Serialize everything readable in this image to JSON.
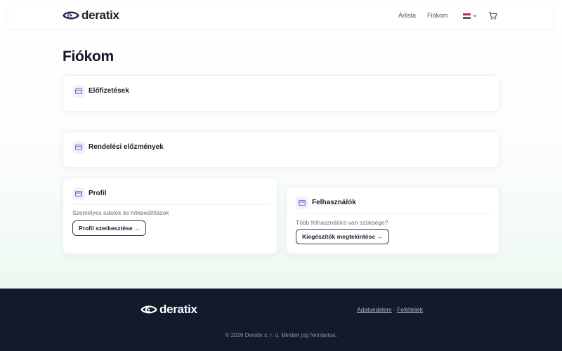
{
  "colors": {
    "text_primary": "#1c1d2b",
    "footer_bg": "#121a2e",
    "icon_accent": "#6b5bd6",
    "card_border": "#eef0f4",
    "page_gradient_end": "#eaf8ef"
  },
  "header": {
    "logo_text": "deratix",
    "nav": [
      {
        "label": "Árlista"
      },
      {
        "label": "Fiókom"
      }
    ],
    "language_icon": "hungary-flag-icon",
    "cart_icon": "cart-icon"
  },
  "page": {
    "title": "Fiókom"
  },
  "cards": {
    "subscriptions": {
      "title": "Előfizetések",
      "icon": "card-icon"
    },
    "orders": {
      "title": "Rendelési előzmények",
      "icon": "card-icon"
    },
    "profile": {
      "title": "Profil",
      "icon": "card-icon",
      "description": "Személyes adatok és hőkbeállítások",
      "button_label": "Profil szerkesztése →"
    },
    "users": {
      "title": "Felhasználók",
      "icon": "card-icon",
      "description": "Több felhasználóra van szüksége?",
      "button_label": "Kiegészítők megtekintése →"
    }
  },
  "footer": {
    "logo_text": "deratix",
    "links": [
      {
        "label": "Adatvédelem"
      },
      {
        "label": "Feltételek"
      }
    ],
    "separator": " · ",
    "copyright": "© 2026 Deratix s. r. o. Minden jog fenntartva."
  }
}
